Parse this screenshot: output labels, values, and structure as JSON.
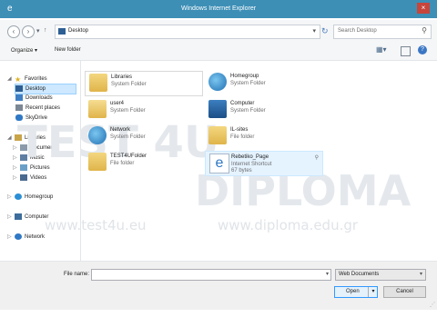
{
  "window": {
    "title": "Windows Internet Explorer",
    "close": "×"
  },
  "address": {
    "location": "Desktop",
    "search_placeholder": "Search Desktop"
  },
  "toolbar": {
    "organize": "Organize ▾",
    "new_folder": "New folder"
  },
  "tree": {
    "favorites": "Favorites",
    "desktop": "Desktop",
    "downloads": "Downloads",
    "recent": "Recent places",
    "skydrive": "SkyDrive",
    "libraries": "Libraries",
    "documents": "Documents",
    "music": "Music",
    "pictures": "Pictures",
    "videos": "Videos",
    "homegroup": "Homegroup",
    "computer": "Computer",
    "network": "Network"
  },
  "items": [
    {
      "name": "Libraries",
      "type": "System Folder"
    },
    {
      "name": "Homegroup",
      "type": "System Folder"
    },
    {
      "name": "user4",
      "type": "System Folder"
    },
    {
      "name": "Computer",
      "type": "System Folder"
    },
    {
      "name": "Network",
      "type": "System Folder"
    },
    {
      "name": "IL-sites",
      "type": "File folder"
    },
    {
      "name": "TEST4UFolder",
      "type": "File folder"
    },
    {
      "name": "Rebetiko_Page",
      "type": "Internet Shortcut",
      "size": "67 bytes"
    }
  ],
  "watermark": {
    "brand1": "TEST 4U",
    "brand2": "DIPLOMA",
    "url1": "www.test4u.eu",
    "url2": "www.diploma.edu.gr"
  },
  "footer": {
    "file_name_label": "File name:",
    "file_name_value": "",
    "file_type": "Web Documents",
    "open": "Open",
    "cancel": "Cancel"
  }
}
